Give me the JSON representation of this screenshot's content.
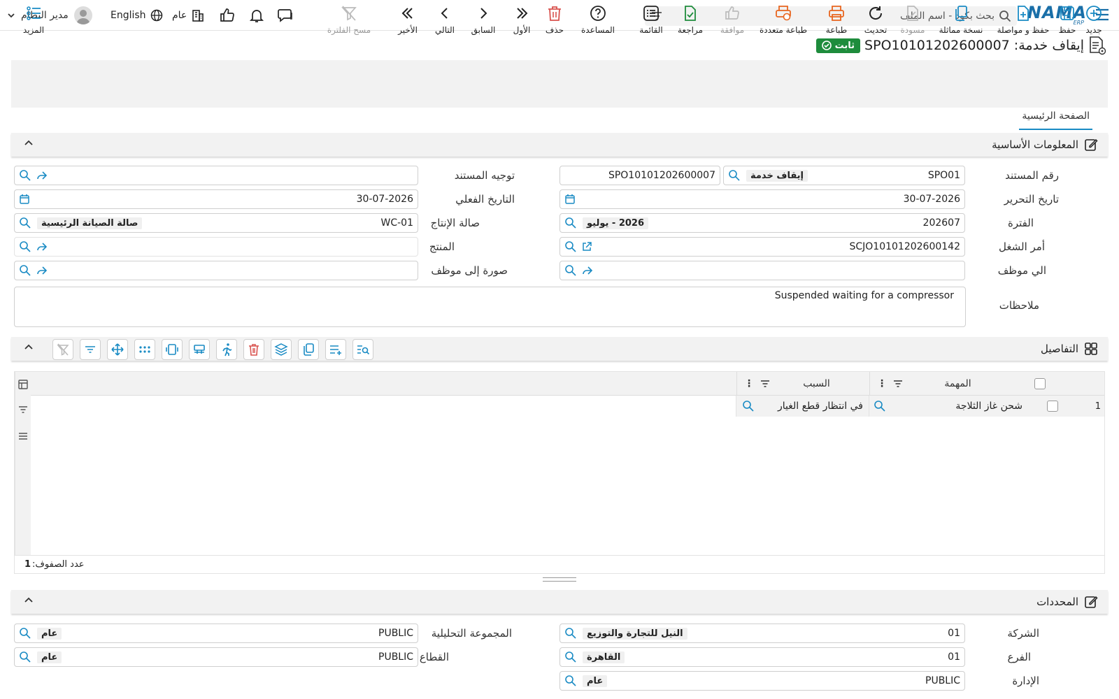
{
  "topbar": {
    "logo": "NAMA",
    "logo_sub": "ERP",
    "search_placeholder": "بحث بكود - اسم الملف",
    "company_label": "عام",
    "language_label": "English",
    "user_name": "مدير النظام"
  },
  "title": {
    "document_title": "إيقاف خدمة: SPO10101202600007",
    "status_badge": "ثابت"
  },
  "toolbar": {
    "new": "جديد",
    "save": "حفظ",
    "save_continue": "حفظ و مواصلة",
    "duplicate": "نسخة مماثلة",
    "draft": "مسودة",
    "refresh": "تحديث",
    "print": "طباعة",
    "multi_print": "طباعة متعددة",
    "approve": "موافقة",
    "review": "مراجعة",
    "list": "القائمة",
    "help": "المساعدة",
    "delete": "حذف",
    "first": "الأول",
    "previous": "السابق",
    "next": "التالي",
    "last": "الأخير",
    "clear_filter": "مسح الفلترة",
    "more": "المزيد"
  },
  "tabs": {
    "main": "الصفحة الرئيسية"
  },
  "basic_info": {
    "section_title": "المعلومات الأساسية",
    "doc_number_label": "رقم المستند",
    "doc_book": "SPO01",
    "doc_book_name": "إيقاف خدمة",
    "doc_code": "SPO10101202600007",
    "doc_direction_label": "توجيه المستند",
    "doc_direction_value": "",
    "issue_date_label": "تاريخ التحرير",
    "issue_date": "30-07-2026",
    "actual_date_label": "التاريخ الفعلي",
    "actual_date": "30-07-2026",
    "period_label": "الفترة",
    "period_code": "202607",
    "period_name": "2026 - يوليو",
    "workcenter_label": "صالة الإنتاج",
    "workcenter_code": "WC-01",
    "workcenter_name": "صالة الصيانة الرئيسية",
    "job_order_label": "أمر الشغل",
    "job_order_value": "SCJO10101202600142",
    "product_label": "المنتج",
    "product_value": "",
    "to_employee_label": "الي موظف",
    "to_employee_value": "",
    "cc_employee_label": "صورة إلى موظف",
    "cc_employee_value": "",
    "notes_label": "ملاحظات",
    "notes_value": "Suspended waiting for a compressor"
  },
  "details": {
    "section_title": "التفاصيل",
    "columns": {
      "task": "المهمة",
      "reason": "السبب"
    },
    "rows": [
      {
        "index": "1",
        "task": "شحن غاز الثلاجة",
        "reason": "في انتظار قطع الغيار"
      }
    ],
    "row_count_label": "عدد الصفوف:",
    "row_count": "1"
  },
  "dimensions": {
    "section_title": "المحددات",
    "company_label": "الشركة",
    "company_code": "01",
    "company_name": "النيل للتجارة والتوزيع",
    "analytic_group_label": "المجموعة التحليلية",
    "analytic_group_code": "PUBLIC",
    "analytic_group_name": "عام",
    "branch_label": "الفرع",
    "branch_code": "01",
    "branch_name": "القاهرة",
    "sector_label": "القطاع",
    "sector_code": "PUBLIC",
    "sector_name": "عام",
    "department_label": "الإدارة",
    "department_code": "PUBLIC",
    "department_name": "عام"
  },
  "colors": {
    "accent": "#1a8bc4",
    "badge": "#1e8c3c",
    "delete": "#d9534f",
    "print": "#e8651e"
  }
}
